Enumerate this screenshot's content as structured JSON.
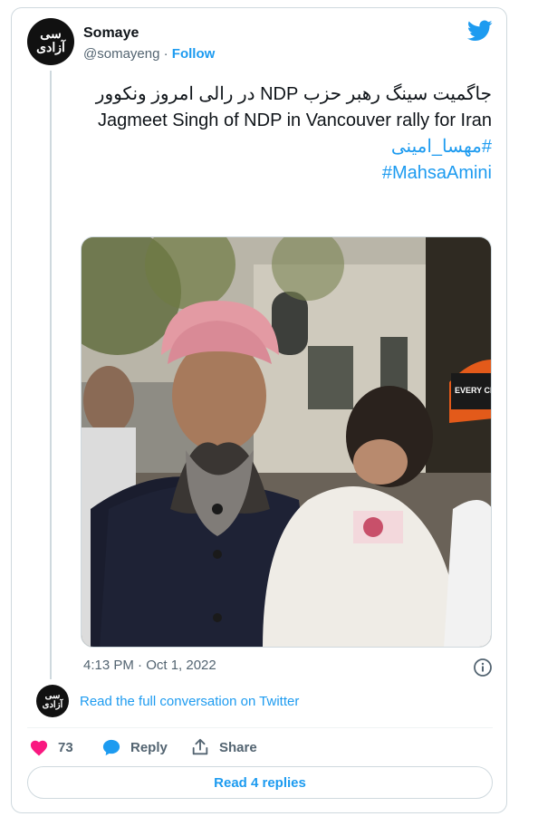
{
  "author": {
    "name": "Somaye",
    "handle": "@somayeng",
    "separator": " · ",
    "follow_label": "Follow",
    "avatar_text": "سی آزادی"
  },
  "tweet": {
    "text_fa": "جاگمیت سینگ رهبر حزب NDP در رالی امروز ونکوور",
    "text_en": "Jagmeet Singh of NDP in Vancouver rally for Iran",
    "hashtag_fa": "#مهسا_امینی",
    "hashtag_en": "#MahsaAmini",
    "timestamp": "4:13 PM · Oct 1, 2022"
  },
  "conversation": {
    "link_label": "Read the full conversation on Twitter"
  },
  "actions": {
    "like_count": "73",
    "reply_label": "Reply",
    "share_label": "Share"
  },
  "replies": {
    "read_label": "Read 4 replies"
  },
  "photo": {
    "sign_text": "EVERY CHILD"
  },
  "colors": {
    "brand": "#1d9bf0",
    "like": "#f91880",
    "muted": "#536471",
    "border": "#cfd9de"
  },
  "icons": [
    "twitter-bird-icon",
    "info-icon",
    "heart-icon",
    "reply-bubble-icon",
    "share-icon"
  ]
}
